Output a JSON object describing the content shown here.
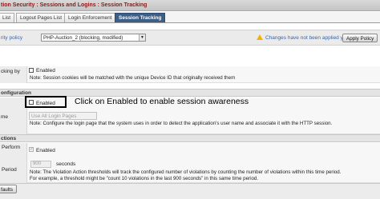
{
  "header": {
    "title": "tion Security : Sessions and Logins : Session Tracking"
  },
  "tabs": [
    {
      "label": "List"
    },
    {
      "label": "Logout Pages List"
    },
    {
      "label": "Login Enforcement"
    },
    {
      "label": "Session Tracking"
    }
  ],
  "policy": {
    "label": "rity policy",
    "selected": "PHP-Auction_2 (blocking, modified)",
    "warning": "Changes have not been applied yet",
    "apply_label": "Apply Policy"
  },
  "tracking_by": {
    "label": "cking by",
    "checkbox_label": "Enabled",
    "checked": false,
    "note": "Note: Session cookies will be matched with the unique Device ID that originally received them"
  },
  "configuration": {
    "section": "onfiguration",
    "checkbox_label": "Enabled",
    "checked": false,
    "callout": "Click on Enabled to enable session awareness",
    "name_label": "me",
    "select_value": "Use All Login Pages",
    "note": "Note: Configure the login page that the system uses in order to detect the application's user name and associate it with the HTTP session."
  },
  "actions": {
    "section": "ctions",
    "perform_label": "Perform",
    "checkbox_label": "Enabled",
    "checked": true,
    "period_label": "Period",
    "period_value": "900",
    "period_unit": "seconds",
    "note_line1": "Note: The Violation Action thresholds will track the configured number of violations by counting the number of violations within this time period.",
    "note_line2": "For example, a threshold might be \"count 10 violations in the last 900 seconds\" in this same time period."
  },
  "footer": {
    "defaults_label": "faults"
  },
  "colors": {
    "active_tab": "#3d5f86",
    "title_text": "#8a1a1a",
    "warning": "#f0b400",
    "warning_text": "#3a66a8"
  }
}
